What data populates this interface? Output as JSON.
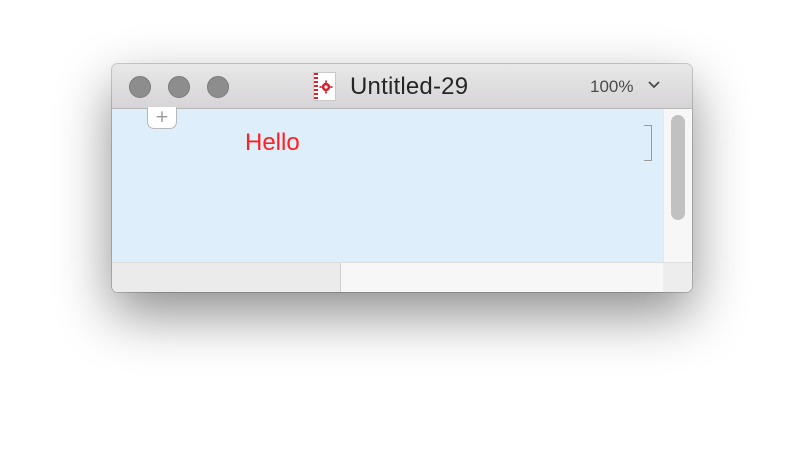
{
  "window": {
    "title": "Untitled-29",
    "zoom_label": "100%",
    "icons": {
      "document": "document-icon",
      "zoom_chevron": "chevron-down-icon",
      "add": "add-icon"
    }
  },
  "canvas": {
    "text": "Hello",
    "add_label": "+",
    "text_color": "#ff2020",
    "background_color": "#deeefb"
  }
}
